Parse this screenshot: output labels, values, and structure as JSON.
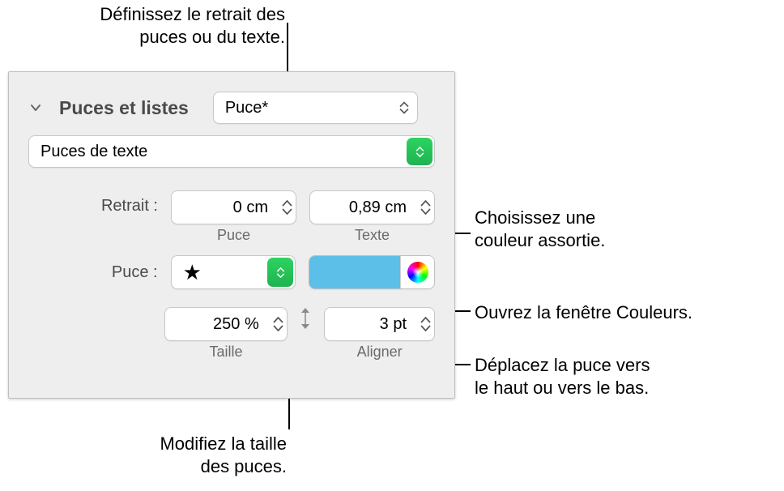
{
  "callouts": {
    "indent": "Définissez le retrait des\npuces ou du texte.",
    "color": "Choisissez une\ncouleur assortie.",
    "window": "Ouvrez la fenêtre Couleurs.",
    "move": "Déplacez la puce vers\nle haut ou vers le bas.",
    "size": "Modifiez la taille\ndes puces."
  },
  "section": {
    "title": "Puces et listes"
  },
  "style_select": {
    "value": "Puce*"
  },
  "type_select": {
    "value": "Puces de texte"
  },
  "indent": {
    "label": "Retrait :",
    "bullet": {
      "value": "0 cm",
      "caption": "Puce"
    },
    "text": {
      "value": "0,89 cm",
      "caption": "Texte"
    }
  },
  "bullet": {
    "label": "Puce :",
    "glyph": "★"
  },
  "size": {
    "value": "250 %",
    "caption": "Taille"
  },
  "align": {
    "value": "3 pt",
    "caption": "Aligner"
  }
}
